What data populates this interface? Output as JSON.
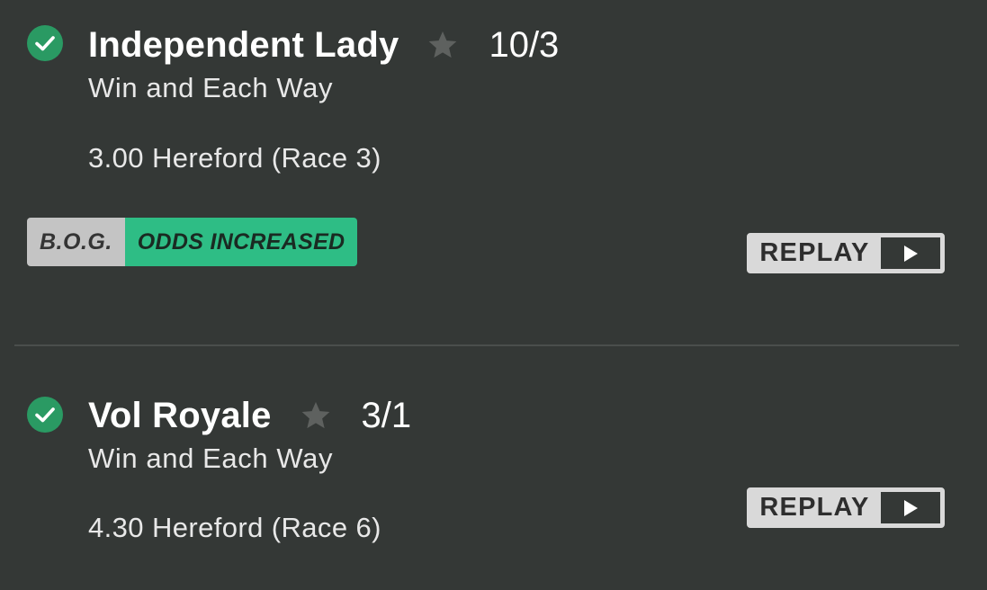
{
  "bets": [
    {
      "selection": "Independent Lady",
      "odds": "10/3",
      "market": "Win and Each Way",
      "event": "3.00 Hereford (Race 3)",
      "badge": {
        "label": "B.O.G.",
        "status": "ODDS INCREASED"
      },
      "replay_label": "REPLAY"
    },
    {
      "selection": "Vol Royale",
      "odds": "3/1",
      "market": "Win and Each Way",
      "event": "4.30 Hereford (Race 6)",
      "replay_label": "REPLAY"
    }
  ],
  "icons": {
    "status": "checkmark-icon",
    "favourite": "star-icon",
    "play": "play-icon"
  },
  "colors": {
    "background": "#343836",
    "win_green": "#2a9a63",
    "bog_green": "#2ebd85",
    "bog_grey": "#c4c4c4",
    "replay_grey": "#d9d9d9",
    "star_grey": "#5e615f"
  }
}
